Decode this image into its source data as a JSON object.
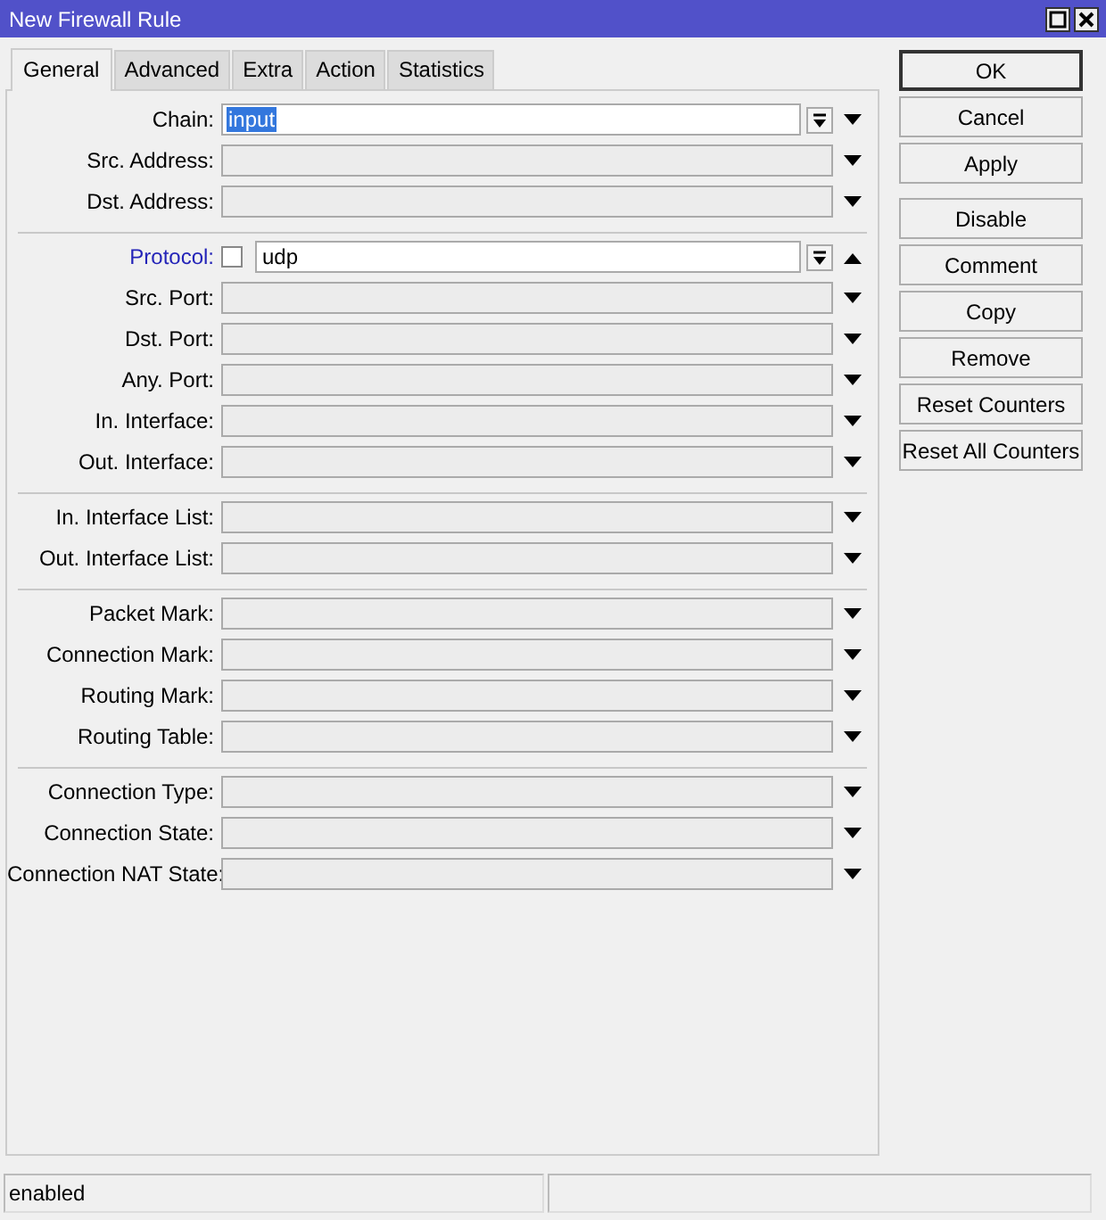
{
  "window": {
    "title": "New Firewall Rule"
  },
  "tabs": [
    {
      "label": "General",
      "selected": true
    },
    {
      "label": "Advanced",
      "selected": false
    },
    {
      "label": "Extra",
      "selected": false
    },
    {
      "label": "Action",
      "selected": false
    },
    {
      "label": "Statistics",
      "selected": false
    }
  ],
  "sections": [
    {
      "fields": [
        {
          "label": "Chain:",
          "kind": "combo",
          "value": "input",
          "value_highlighted": true,
          "active": false,
          "expanded": false
        },
        {
          "label": "Src. Address:",
          "kind": "empty",
          "active": false,
          "expanded": false
        },
        {
          "label": "Dst. Address:",
          "kind": "empty",
          "active": false,
          "expanded": false
        }
      ]
    },
    {
      "fields": [
        {
          "label": "Protocol:",
          "kind": "combo",
          "value": "udp",
          "value_highlighted": false,
          "negated": false,
          "active": true,
          "expanded": true
        },
        {
          "label": "Src. Port:",
          "kind": "empty",
          "active": false,
          "expanded": false
        },
        {
          "label": "Dst. Port:",
          "kind": "empty",
          "active": false,
          "expanded": false
        },
        {
          "label": "Any. Port:",
          "kind": "empty",
          "active": false,
          "expanded": false
        },
        {
          "label": "In. Interface:",
          "kind": "empty",
          "active": false,
          "expanded": false
        },
        {
          "label": "Out. Interface:",
          "kind": "empty",
          "active": false,
          "expanded": false
        }
      ]
    },
    {
      "fields": [
        {
          "label": "In. Interface List:",
          "kind": "empty",
          "active": false,
          "expanded": false
        },
        {
          "label": "Out. Interface List:",
          "kind": "empty",
          "active": false,
          "expanded": false
        }
      ]
    },
    {
      "fields": [
        {
          "label": "Packet Mark:",
          "kind": "empty",
          "active": false,
          "expanded": false
        },
        {
          "label": "Connection Mark:",
          "kind": "empty",
          "active": false,
          "expanded": false
        },
        {
          "label": "Routing Mark:",
          "kind": "empty",
          "active": false,
          "expanded": false
        },
        {
          "label": "Routing Table:",
          "kind": "empty",
          "active": false,
          "expanded": false
        }
      ]
    },
    {
      "fields": [
        {
          "label": "Connection Type:",
          "kind": "empty",
          "active": false,
          "expanded": false
        },
        {
          "label": "Connection State:",
          "kind": "empty",
          "active": false,
          "expanded": false
        },
        {
          "label": "Connection NAT State:",
          "kind": "empty",
          "active": false,
          "expanded": false
        }
      ]
    }
  ],
  "button_groups": [
    {
      "buttons": [
        {
          "label": "OK",
          "default": true
        },
        {
          "label": "Cancel",
          "default": false
        },
        {
          "label": "Apply",
          "default": false
        }
      ]
    },
    {
      "buttons": [
        {
          "label": "Disable",
          "default": false
        },
        {
          "label": "Comment",
          "default": false
        },
        {
          "label": "Copy",
          "default": false
        },
        {
          "label": "Remove",
          "default": false
        },
        {
          "label": "Reset Counters",
          "default": false
        },
        {
          "label": "Reset All Counters",
          "default": false
        }
      ]
    }
  ],
  "status_bar": {
    "status": "enabled"
  }
}
